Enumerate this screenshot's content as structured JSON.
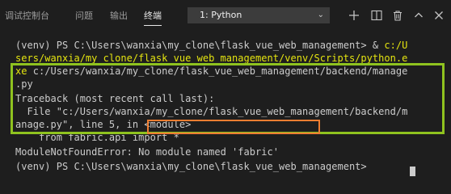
{
  "tabs": [
    {
      "label": "调试控制台"
    },
    {
      "label": "问题"
    },
    {
      "label": "输出"
    },
    {
      "label": "终端",
      "active": true
    }
  ],
  "terminal_select": {
    "value": "1: Python"
  },
  "terminal": {
    "lines": [
      "(venv) PS C:\\Users\\wanxia\\my_clone\\flask_vue_web_management> & ",
      "c:/U",
      "sers/wanxia/my_clone/flask_vue_web_management/venv/Scripts/python.e",
      "xe",
      " c:/Users/wanxia/my_clone/flask_vue_web_management/backend/manage",
      ".py",
      "Traceback (most recent call last):",
      "  File \"c:/Users/wanxia/my_clone/flask_vue_web_management/backend/m",
      "anage.py\", line 5, in <module>",
      "    from fabric.api import *",
      "ModuleNotFoundError: ",
      "No module named 'fabric'",
      "(venv) PS C:\\Users\\wanxia\\my_clone\\flask_vue_web_management> "
    ]
  },
  "colors": {
    "background": "#1e1e1e",
    "text": "#cccccc",
    "path_highlight": "#e5e510",
    "traceback_box": "#8fc31f",
    "error_box": "#ed7d31"
  }
}
